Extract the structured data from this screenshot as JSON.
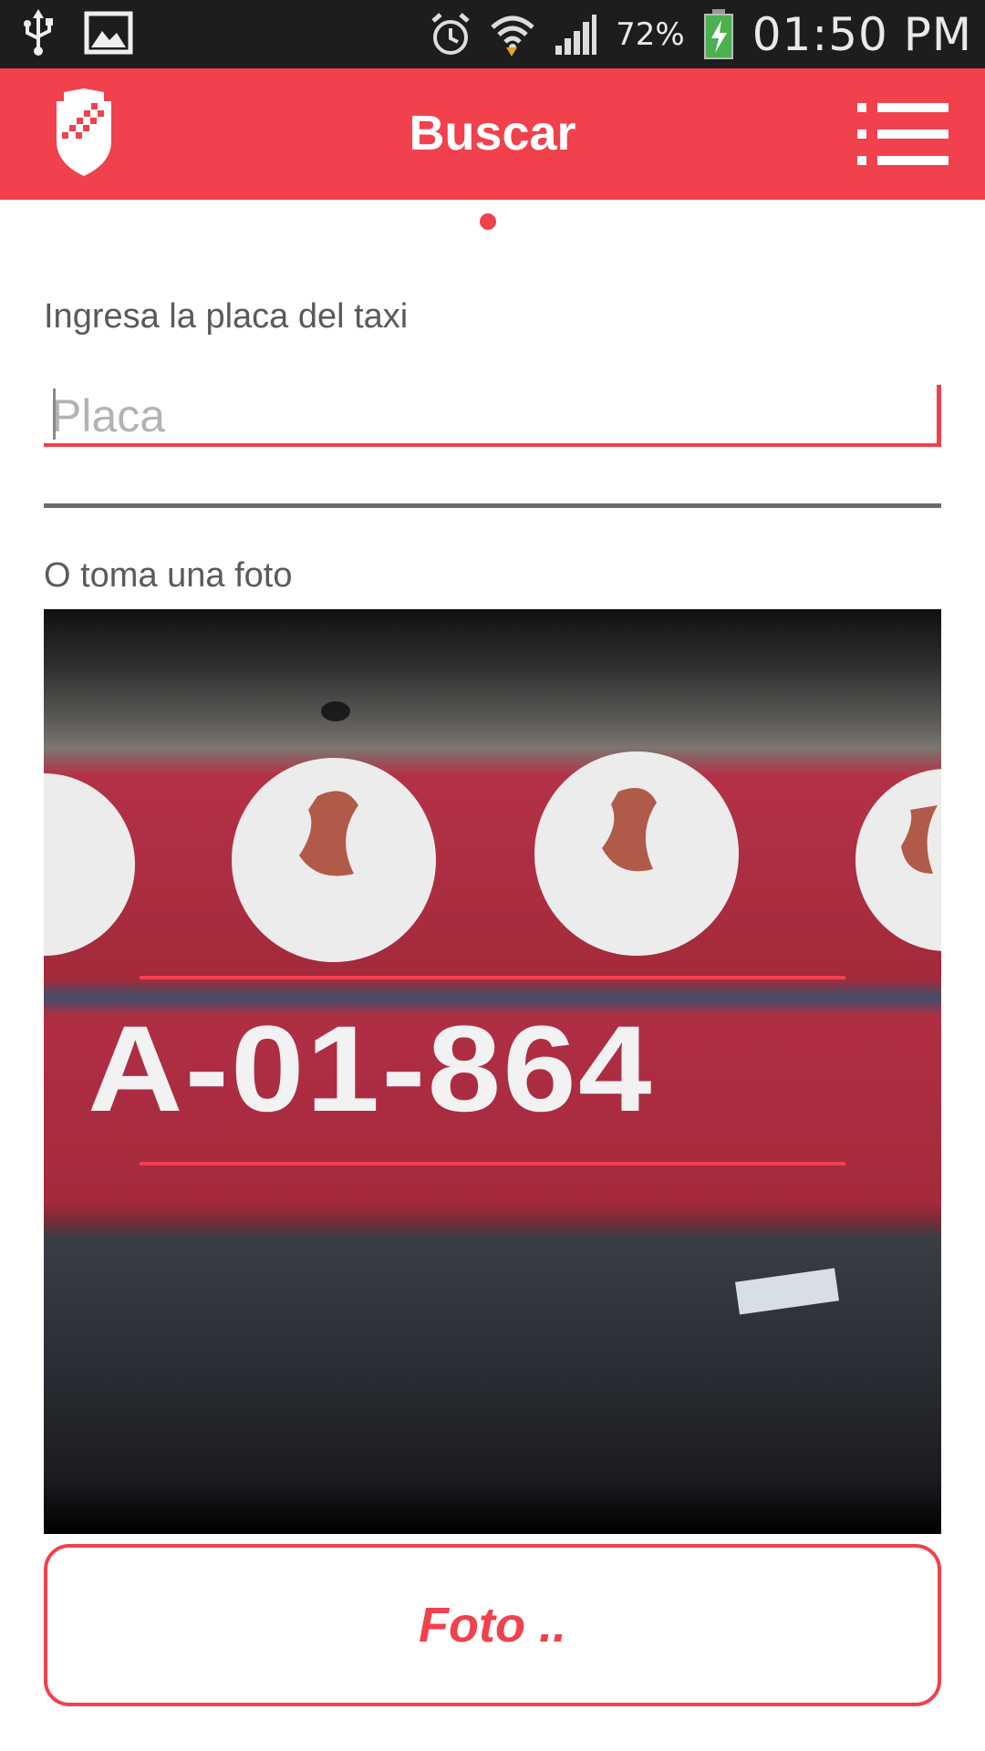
{
  "status_bar": {
    "battery_percent": "72%",
    "time": "01:50 PM",
    "icons": [
      "usb-icon",
      "image-icon",
      "alarm-icon",
      "wifi-icon",
      "signal-icon",
      "battery-charging-icon"
    ]
  },
  "app_bar": {
    "title": "Buscar",
    "logo_icon": "shield-logo-icon",
    "menu_icon": "menu-list-icon"
  },
  "form": {
    "plate_label": "Ingresa la placa del taxi",
    "plate_placeholder": "Placa",
    "plate_value": "",
    "photo_label": "O toma una foto"
  },
  "photo": {
    "plate_text": "A-01-864"
  },
  "actions": {
    "photo_button_label": "Foto .."
  },
  "colors": {
    "accent": "#f0414d",
    "status_bar": "#1d1d1d",
    "label_text": "#5a5a5a"
  }
}
